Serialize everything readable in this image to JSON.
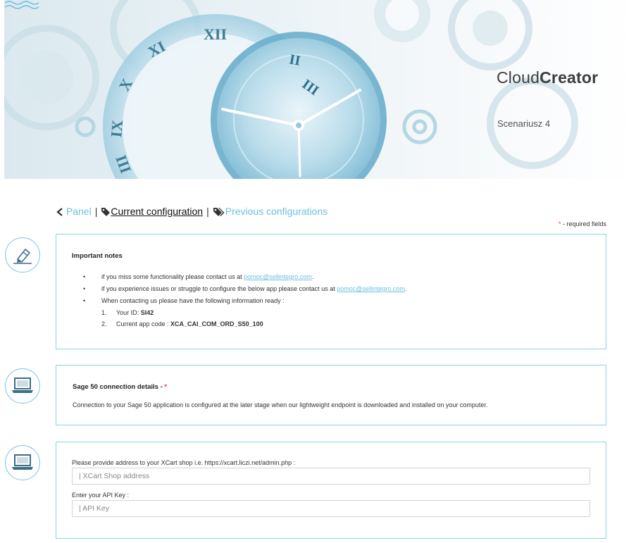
{
  "header": {
    "brand_light": "Cloud",
    "brand_bold": "Creator",
    "scenario": "Scenariusz 4"
  },
  "nav": {
    "back_label": "Panel",
    "separator": "|",
    "current_label": "Current configuration",
    "previous_label": "Previous configurations"
  },
  "required_note": {
    "star": "*",
    "text": " - required fields"
  },
  "notes": {
    "title": "Important notes",
    "bullet": "•",
    "items": [
      {
        "text": "if you miss some functionality please contact us at ",
        "link": "pomoc@sellintegro.com",
        "tail": "."
      },
      {
        "text": "if you experience issues or struggle to configure the below app please contact us at ",
        "link": "pomoc@sellintegro.com",
        "tail": "."
      },
      {
        "text": "When contacting us please have the following information ready :"
      }
    ],
    "sub": [
      {
        "num": "1.",
        "label": "Your ID: ",
        "value": "SI42"
      },
      {
        "num": "2.",
        "label": "Current app code : ",
        "value": "XCA_CAI_COM_ORD_S50_100"
      }
    ]
  },
  "sage": {
    "title": "Sage 50 connection details - ",
    "star": "*",
    "description": "Connection to your Sage 50 application is configured at the later stage when our lightweight endpoint is downloaded and installed on your computer."
  },
  "xcart": {
    "address_label": "Please provide address to your XCart shop i.e. https://xcart.liczi.net/admin.php :",
    "address_placeholder": "| XCart Shop address",
    "address_value": "",
    "apikey_label": "Enter your API Key :",
    "apikey_placeholder": "| API Key",
    "apikey_value": ""
  },
  "colors": {
    "accent": "#6cc0dc",
    "panel_border": "#8fd0e4",
    "required": "#ee3333"
  },
  "icons": {
    "side_1": "pen-sign-icon",
    "side_2": "laptop-icon",
    "side_3": "laptop-icon",
    "nav_back": "chevron-left-icon",
    "nav_current": "tag-icon",
    "nav_previous": "tags-icon"
  }
}
